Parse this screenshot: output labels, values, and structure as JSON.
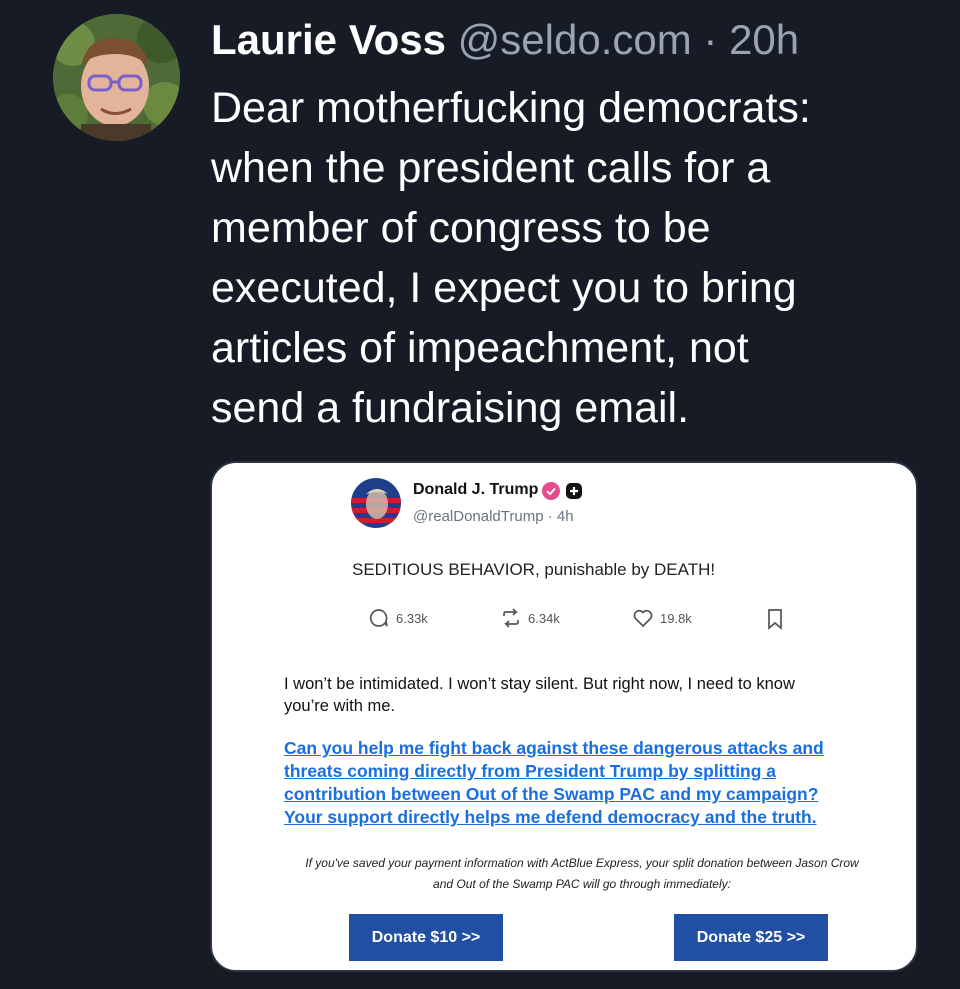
{
  "tweet": {
    "author_name": "Laurie Voss",
    "author_handle": "@seldo.com",
    "separator": "·",
    "time": "20h",
    "text": "Dear motherfucking democrats:\nwhen the president calls for a\nmember of congress to be\nexecuted, I expect you to bring\narticles of impeachment, not\nsend a fundraising email."
  },
  "embedded_image": {
    "truth_post": {
      "name": "Donald J. Trump",
      "handle": "@realDonaldTrump",
      "time": "· 4h",
      "text": "SEDITIOUS BEHAVIOR, punishable by DEATH!",
      "stats": {
        "replies": "6.33k",
        "retruths": "6.34k",
        "likes": "19.8k"
      }
    },
    "email": {
      "text": "I won’t be intimidated. I won’t stay silent. But right now, I need to know\nyou’re with me.",
      "link": "Can you help me fight back against these dangerous attacks and\nthreats coming directly from President Trump by splitting a\ncontribution between Out of the Swamp PAC and my campaign?\nYour support directly helps me defend democracy and the truth.",
      "note": "If you've saved your payment information with ActBlue Express, your split donation between Jason Crow\nand Out of the Swamp PAC will go through immediately:",
      "donate_10": "Donate $10 >>",
      "donate_25": "Donate $25 >>"
    }
  },
  "colors": {
    "background": "#161b26",
    "handle_gray": "#9aa3b2",
    "link_blue": "#1a6fe0",
    "donate_blue": "#214fa3",
    "verified_pink": "#e64b8d"
  },
  "icons": [
    "reply-icon",
    "retruth-icon",
    "like-icon",
    "bookmark-icon",
    "verified-icon",
    "plus-badge-icon"
  ]
}
